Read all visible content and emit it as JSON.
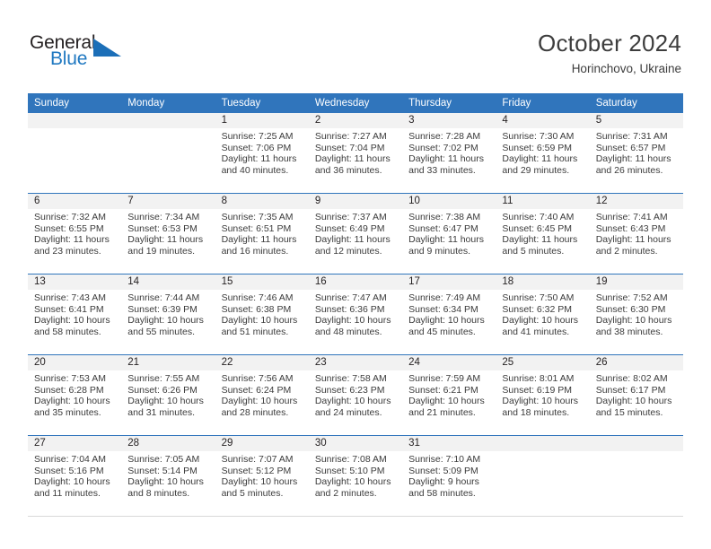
{
  "logo": {
    "primary_text": "General",
    "secondary_text": "Blue",
    "icon": "triangle-icon",
    "primary_color": "#231f20",
    "secondary_color": "#1f78c1"
  },
  "header": {
    "title": "October 2024",
    "subtitle": "Horinchovo, Ukraine"
  },
  "theme": {
    "header_blue": "#3075bc",
    "band_gray": "#f2f2f2",
    "text": "#231f20"
  },
  "calendar": {
    "weekday_headers": [
      "Sunday",
      "Monday",
      "Tuesday",
      "Wednesday",
      "Thursday",
      "Friday",
      "Saturday"
    ],
    "weeks": [
      [
        {
          "day": "",
          "sunrise": "",
          "sunset": "",
          "daylight": ""
        },
        {
          "day": "",
          "sunrise": "",
          "sunset": "",
          "daylight": ""
        },
        {
          "day": "1",
          "sunrise": "Sunrise: 7:25 AM",
          "sunset": "Sunset: 7:06 PM",
          "daylight": "Daylight: 11 hours and 40 minutes."
        },
        {
          "day": "2",
          "sunrise": "Sunrise: 7:27 AM",
          "sunset": "Sunset: 7:04 PM",
          "daylight": "Daylight: 11 hours and 36 minutes."
        },
        {
          "day": "3",
          "sunrise": "Sunrise: 7:28 AM",
          "sunset": "Sunset: 7:02 PM",
          "daylight": "Daylight: 11 hours and 33 minutes."
        },
        {
          "day": "4",
          "sunrise": "Sunrise: 7:30 AM",
          "sunset": "Sunset: 6:59 PM",
          "daylight": "Daylight: 11 hours and 29 minutes."
        },
        {
          "day": "5",
          "sunrise": "Sunrise: 7:31 AM",
          "sunset": "Sunset: 6:57 PM",
          "daylight": "Daylight: 11 hours and 26 minutes."
        }
      ],
      [
        {
          "day": "6",
          "sunrise": "Sunrise: 7:32 AM",
          "sunset": "Sunset: 6:55 PM",
          "daylight": "Daylight: 11 hours and 23 minutes."
        },
        {
          "day": "7",
          "sunrise": "Sunrise: 7:34 AM",
          "sunset": "Sunset: 6:53 PM",
          "daylight": "Daylight: 11 hours and 19 minutes."
        },
        {
          "day": "8",
          "sunrise": "Sunrise: 7:35 AM",
          "sunset": "Sunset: 6:51 PM",
          "daylight": "Daylight: 11 hours and 16 minutes."
        },
        {
          "day": "9",
          "sunrise": "Sunrise: 7:37 AM",
          "sunset": "Sunset: 6:49 PM",
          "daylight": "Daylight: 11 hours and 12 minutes."
        },
        {
          "day": "10",
          "sunrise": "Sunrise: 7:38 AM",
          "sunset": "Sunset: 6:47 PM",
          "daylight": "Daylight: 11 hours and 9 minutes."
        },
        {
          "day": "11",
          "sunrise": "Sunrise: 7:40 AM",
          "sunset": "Sunset: 6:45 PM",
          "daylight": "Daylight: 11 hours and 5 minutes."
        },
        {
          "day": "12",
          "sunrise": "Sunrise: 7:41 AM",
          "sunset": "Sunset: 6:43 PM",
          "daylight": "Daylight: 11 hours and 2 minutes."
        }
      ],
      [
        {
          "day": "13",
          "sunrise": "Sunrise: 7:43 AM",
          "sunset": "Sunset: 6:41 PM",
          "daylight": "Daylight: 10 hours and 58 minutes."
        },
        {
          "day": "14",
          "sunrise": "Sunrise: 7:44 AM",
          "sunset": "Sunset: 6:39 PM",
          "daylight": "Daylight: 10 hours and 55 minutes."
        },
        {
          "day": "15",
          "sunrise": "Sunrise: 7:46 AM",
          "sunset": "Sunset: 6:38 PM",
          "daylight": "Daylight: 10 hours and 51 minutes."
        },
        {
          "day": "16",
          "sunrise": "Sunrise: 7:47 AM",
          "sunset": "Sunset: 6:36 PM",
          "daylight": "Daylight: 10 hours and 48 minutes."
        },
        {
          "day": "17",
          "sunrise": "Sunrise: 7:49 AM",
          "sunset": "Sunset: 6:34 PM",
          "daylight": "Daylight: 10 hours and 45 minutes."
        },
        {
          "day": "18",
          "sunrise": "Sunrise: 7:50 AM",
          "sunset": "Sunset: 6:32 PM",
          "daylight": "Daylight: 10 hours and 41 minutes."
        },
        {
          "day": "19",
          "sunrise": "Sunrise: 7:52 AM",
          "sunset": "Sunset: 6:30 PM",
          "daylight": "Daylight: 10 hours and 38 minutes."
        }
      ],
      [
        {
          "day": "20",
          "sunrise": "Sunrise: 7:53 AM",
          "sunset": "Sunset: 6:28 PM",
          "daylight": "Daylight: 10 hours and 35 minutes."
        },
        {
          "day": "21",
          "sunrise": "Sunrise: 7:55 AM",
          "sunset": "Sunset: 6:26 PM",
          "daylight": "Daylight: 10 hours and 31 minutes."
        },
        {
          "day": "22",
          "sunrise": "Sunrise: 7:56 AM",
          "sunset": "Sunset: 6:24 PM",
          "daylight": "Daylight: 10 hours and 28 minutes."
        },
        {
          "day": "23",
          "sunrise": "Sunrise: 7:58 AM",
          "sunset": "Sunset: 6:23 PM",
          "daylight": "Daylight: 10 hours and 24 minutes."
        },
        {
          "day": "24",
          "sunrise": "Sunrise: 7:59 AM",
          "sunset": "Sunset: 6:21 PM",
          "daylight": "Daylight: 10 hours and 21 minutes."
        },
        {
          "day": "25",
          "sunrise": "Sunrise: 8:01 AM",
          "sunset": "Sunset: 6:19 PM",
          "daylight": "Daylight: 10 hours and 18 minutes."
        },
        {
          "day": "26",
          "sunrise": "Sunrise: 8:02 AM",
          "sunset": "Sunset: 6:17 PM",
          "daylight": "Daylight: 10 hours and 15 minutes."
        }
      ],
      [
        {
          "day": "27",
          "sunrise": "Sunrise: 7:04 AM",
          "sunset": "Sunset: 5:16 PM",
          "daylight": "Daylight: 10 hours and 11 minutes."
        },
        {
          "day": "28",
          "sunrise": "Sunrise: 7:05 AM",
          "sunset": "Sunset: 5:14 PM",
          "daylight": "Daylight: 10 hours and 8 minutes."
        },
        {
          "day": "29",
          "sunrise": "Sunrise: 7:07 AM",
          "sunset": "Sunset: 5:12 PM",
          "daylight": "Daylight: 10 hours and 5 minutes."
        },
        {
          "day": "30",
          "sunrise": "Sunrise: 7:08 AM",
          "sunset": "Sunset: 5:10 PM",
          "daylight": "Daylight: 10 hours and 2 minutes."
        },
        {
          "day": "31",
          "sunrise": "Sunrise: 7:10 AM",
          "sunset": "Sunset: 5:09 PM",
          "daylight": "Daylight: 9 hours and 58 minutes."
        },
        {
          "day": "",
          "sunrise": "",
          "sunset": "",
          "daylight": ""
        },
        {
          "day": "",
          "sunrise": "",
          "sunset": "",
          "daylight": ""
        }
      ]
    ]
  }
}
